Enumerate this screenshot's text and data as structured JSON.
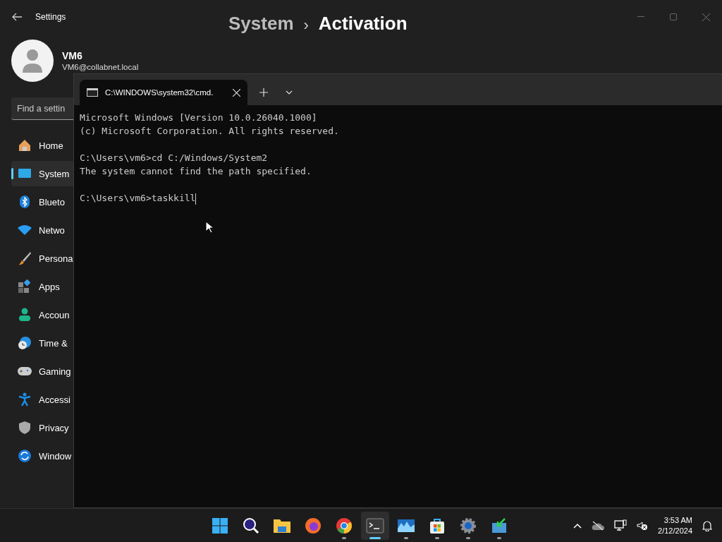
{
  "window": {
    "title": "Settings"
  },
  "user": {
    "name": "VM6",
    "email": "VM6@collabnet.local"
  },
  "search": {
    "placeholder": "Find a settin"
  },
  "breadcrumb": {
    "parent": "System",
    "separator": "›",
    "current": "Activation"
  },
  "sidebar": {
    "items": [
      {
        "label": "Home",
        "kind": "home",
        "selected": false
      },
      {
        "label": "System",
        "kind": "system",
        "selected": true
      },
      {
        "label": "Blueto",
        "kind": "bluetooth",
        "selected": false
      },
      {
        "label": "Netwo",
        "kind": "network",
        "selected": false
      },
      {
        "label": "Persona",
        "kind": "brush",
        "selected": false
      },
      {
        "label": "Apps",
        "kind": "apps",
        "selected": false
      },
      {
        "label": "Accoun",
        "kind": "account",
        "selected": false
      },
      {
        "label": "Time &",
        "kind": "time",
        "selected": false
      },
      {
        "label": "Gaming",
        "kind": "gaming",
        "selected": false
      },
      {
        "label": "Accessi",
        "kind": "access",
        "selected": false
      },
      {
        "label": "Privacy",
        "kind": "shield",
        "selected": false
      },
      {
        "label": "Window",
        "kind": "update",
        "selected": false
      }
    ]
  },
  "terminal": {
    "tab": {
      "title": "C:\\WINDOWS\\system32\\cmd.",
      "selected": true
    },
    "blocks": [
      [
        "Microsoft Windows [Version 10.0.26040.1000]",
        "(c) Microsoft Corporation. All rights reserved."
      ],
      [
        "C:\\Users\\vm6>cd C:/Windows/System2",
        "The system cannot find the path specified."
      ],
      [
        "C:\\Users\\vm6>taskkill"
      ]
    ]
  },
  "taskbar": {
    "apps": [
      {
        "kind": "start",
        "running": false,
        "selected": false
      },
      {
        "kind": "search",
        "running": false,
        "selected": false
      },
      {
        "kind": "folder",
        "running": false,
        "selected": false
      },
      {
        "kind": "firefox",
        "running": false,
        "selected": false
      },
      {
        "kind": "chrome",
        "running": true,
        "selected": false
      },
      {
        "kind": "terminal",
        "running": true,
        "selected": true
      },
      {
        "kind": "photos",
        "running": true,
        "selected": false
      },
      {
        "kind": "store",
        "running": true,
        "selected": false
      },
      {
        "kind": "settings",
        "running": true,
        "selected": false
      },
      {
        "kind": "install",
        "running": true,
        "selected": false
      }
    ],
    "time": "3:53 AM",
    "date": "2/12/2024"
  }
}
